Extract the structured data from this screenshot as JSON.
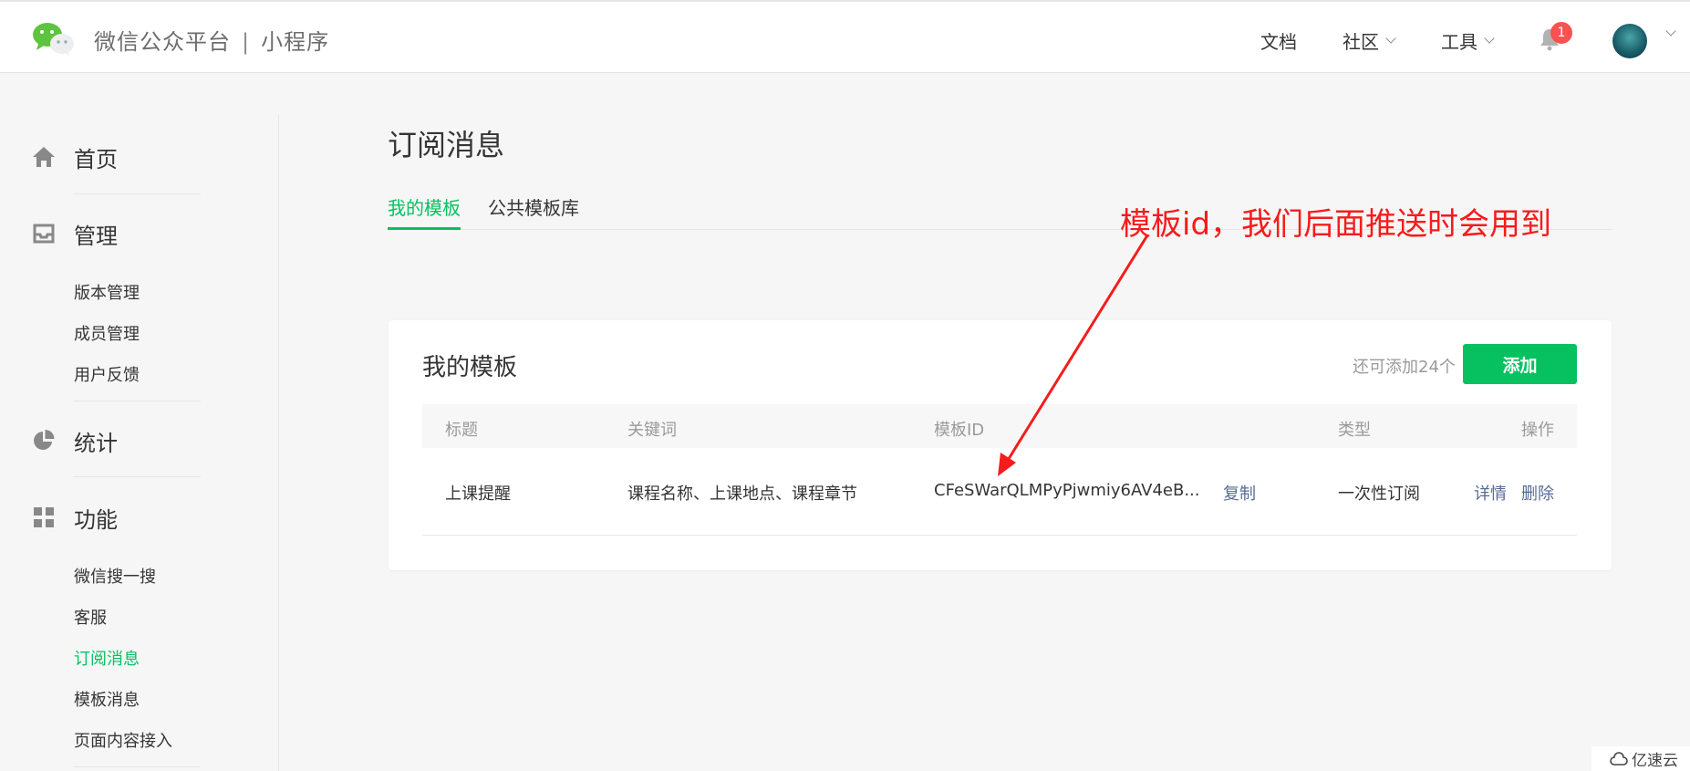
{
  "header": {
    "brand": "微信公众平台",
    "separator": "|",
    "product": "小程序",
    "nav": [
      "文档",
      "社区",
      "工具"
    ],
    "notification_count": "1"
  },
  "sidebar": {
    "sections": [
      {
        "label": "首页",
        "icon": "home-icon"
      },
      {
        "label": "管理",
        "icon": "inbox-icon",
        "items": [
          "版本管理",
          "成员管理",
          "用户反馈"
        ]
      },
      {
        "label": "统计",
        "icon": "pie-chart-icon"
      },
      {
        "label": "功能",
        "icon": "grid-icon",
        "items": [
          "微信搜一搜",
          "客服",
          "订阅消息",
          "模板消息",
          "页面内容接入"
        ]
      }
    ],
    "active_item": "订阅消息"
  },
  "page": {
    "title": "订阅消息",
    "tabs": [
      "我的模板",
      "公共模板库"
    ],
    "active_tab": "我的模板"
  },
  "annotation": "模板id，我们后面推送时会用到",
  "card": {
    "title": "我的模板",
    "remaining": "还可添加24个",
    "add_button": "添加",
    "columns": [
      "标题",
      "关键词",
      "模板ID",
      "类型",
      "操作"
    ],
    "rows": [
      {
        "title": "上课提醒",
        "keywords": "课程名称、上课地点、课程章节",
        "template_id": "CFeSWarQLMPyPjwmiy6AV4eB...",
        "copy": "复制",
        "type": "一次性订阅",
        "detail": "详情",
        "delete": "删除"
      }
    ]
  },
  "watermark": "亿速云",
  "colors": {
    "accent": "#07c160",
    "link": "#576b95",
    "annotation": "#f51c1c",
    "badge": "#fa5151"
  }
}
